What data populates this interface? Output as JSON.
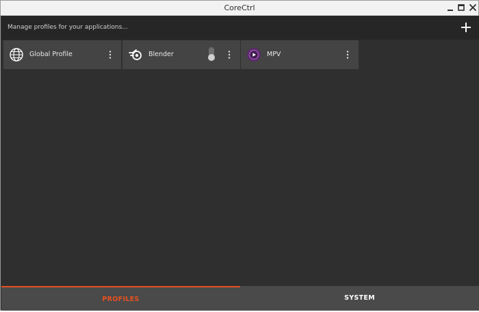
{
  "window": {
    "title": "CoreCtrl"
  },
  "toolbar": {
    "placeholder": "Manage profiles for your applications..."
  },
  "profiles": [
    {
      "label": "Global Profile",
      "icon": "globe-icon"
    },
    {
      "label": "Blender",
      "icon": "blender-icon",
      "toggle_enabled": false
    },
    {
      "label": "MPV",
      "icon": "mpv-icon"
    }
  ],
  "tabs": {
    "profiles": "PROFILES",
    "system": "SYSTEM",
    "active": "profiles"
  },
  "colors": {
    "accent": "#e8501f",
    "card_bg": "#444444",
    "toolbar_bg": "#262626",
    "content_bg": "#2f2f2f",
    "tabbar_bg": "#4a4a4a"
  }
}
